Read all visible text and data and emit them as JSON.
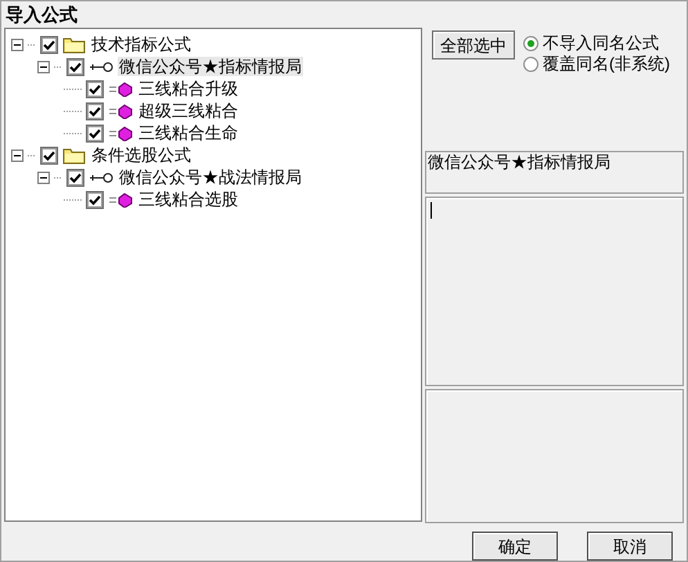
{
  "window": {
    "title": "导入公式"
  },
  "tree": [
    {
      "label": "技术指标公式",
      "kind": "folder",
      "checked": true,
      "expanded": true,
      "selected": false,
      "children": [
        {
          "label": "微信公众号★指标情报局",
          "kind": "group",
          "checked": true,
          "expanded": true,
          "selected": true,
          "children": [
            {
              "label": "三线粘合升级",
              "kind": "formula",
              "checked": true,
              "selected": false
            },
            {
              "label": "超级三线粘合",
              "kind": "formula",
              "checked": true,
              "selected": false
            },
            {
              "label": "三线粘合生命",
              "kind": "formula",
              "checked": true,
              "selected": false
            }
          ]
        }
      ]
    },
    {
      "label": "条件选股公式",
      "kind": "folder",
      "checked": true,
      "expanded": true,
      "selected": false,
      "children": [
        {
          "label": "微信公众号★战法情报局",
          "kind": "group",
          "checked": true,
          "expanded": true,
          "selected": false,
          "children": [
            {
              "label": "三线粘合选股",
              "kind": "formula",
              "checked": true,
              "selected": false
            }
          ]
        }
      ]
    }
  ],
  "select_all_button": "全部选中",
  "options": [
    {
      "label": "不导入同名公式",
      "selected": true
    },
    {
      "label": "覆盖同名(非系统)",
      "selected": false
    }
  ],
  "info_label": "微信公众号★指标情报局",
  "buttons": [
    "确定",
    "取消"
  ]
}
